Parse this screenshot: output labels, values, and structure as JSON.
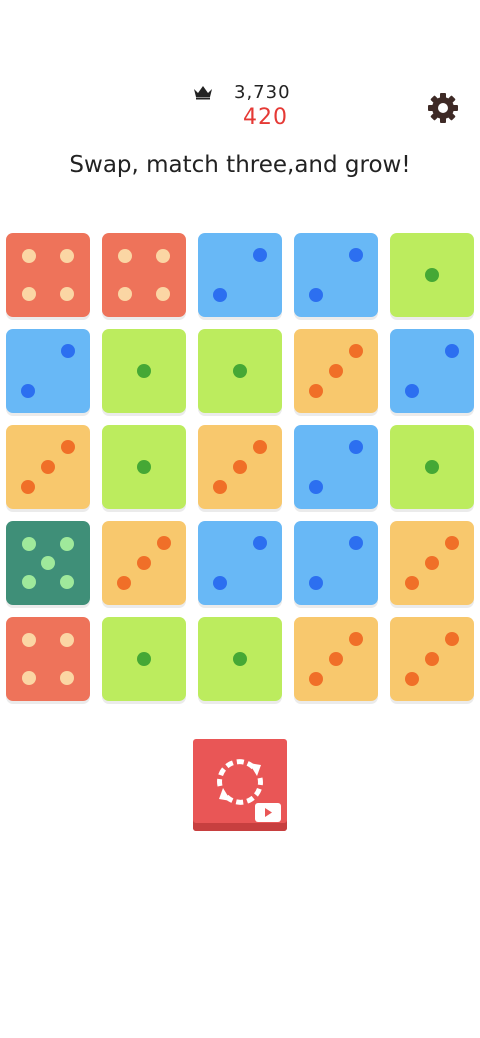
{
  "header": {
    "best_score": "3,730",
    "current_score": "420"
  },
  "tagline": "Swap, match three,and grow!",
  "colors": {
    "red": "#ee735a",
    "red_pip": "#fbd6a4",
    "blue": "#68b8f6",
    "blue_pip": "#2c6ff0",
    "green": "#bcec5e",
    "green_pip": "#45a835",
    "orange": "#f8c86d",
    "orange_pip": "#f06f28",
    "teal": "#3f8f78",
    "teal_pip": "#9fe99b",
    "button": "#e95656"
  },
  "board": [
    [
      {
        "color": "red",
        "value": 4
      },
      {
        "color": "red",
        "value": 4
      },
      {
        "color": "blue",
        "value": 2
      },
      {
        "color": "blue",
        "value": 2
      },
      {
        "color": "green",
        "value": 1
      }
    ],
    [
      {
        "color": "blue",
        "value": 2
      },
      {
        "color": "green",
        "value": 1
      },
      {
        "color": "green",
        "value": 1
      },
      {
        "color": "orange",
        "value": 3
      },
      {
        "color": "blue",
        "value": 2
      }
    ],
    [
      {
        "color": "orange",
        "value": 3
      },
      {
        "color": "green",
        "value": 1
      },
      {
        "color": "orange",
        "value": 3
      },
      {
        "color": "blue",
        "value": 2
      },
      {
        "color": "green",
        "value": 1
      }
    ],
    [
      {
        "color": "teal",
        "value": 5
      },
      {
        "color": "orange",
        "value": 3
      },
      {
        "color": "blue",
        "value": 2
      },
      {
        "color": "blue",
        "value": 2
      },
      {
        "color": "orange",
        "value": 3
      }
    ],
    [
      {
        "color": "red",
        "value": 4
      },
      {
        "color": "green",
        "value": 1
      },
      {
        "color": "green",
        "value": 1
      },
      {
        "color": "orange",
        "value": 3
      },
      {
        "color": "orange",
        "value": 3
      }
    ]
  ],
  "icons": {
    "best": "crown-icon",
    "settings": "gear-icon",
    "refresh": "refresh-icon",
    "video": "video-ad-icon"
  }
}
